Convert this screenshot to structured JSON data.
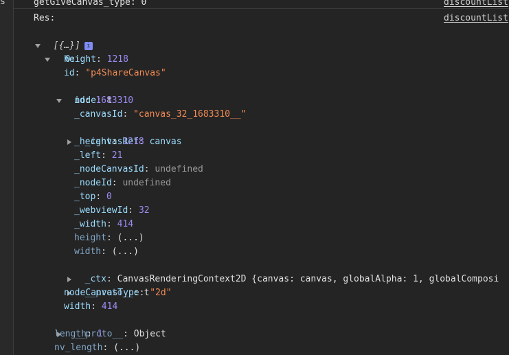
{
  "gutter_char": "s",
  "header_line": {
    "label": "getGiveCanvas_type: 0",
    "right_link": "discountList"
  },
  "res_line": {
    "label": "Res:",
    "right_link": "discountList"
  },
  "info_badge": "i",
  "tree": {
    "root_label": "[{…}]",
    "item_index": "0",
    "height": "1218",
    "id": "\"p4ShareCanvas\"",
    "node_type": "t",
    "node": {
      "id": "1683310",
      "canvasId": "\"canvas_32_1683310__\"",
      "canvasRef": "canvas",
      "_height": "1218",
      "_left": "21",
      "nodeCanvasId": "undefined",
      "nodeId": "undefined",
      "_top": "0",
      "webviewId": "32",
      "_width": "414",
      "getter_height": "(...)",
      "getter_width": "(...)",
      "ctx_value": "CanvasRenderingContext2D {canvas: canvas, globalAlpha: 1, globalComposi",
      "proto": "t"
    },
    "nodeCanvasType": "\"2d\"",
    "width": "414",
    "proto": "Object",
    "length": "1",
    "nv_length": "(...)"
  }
}
